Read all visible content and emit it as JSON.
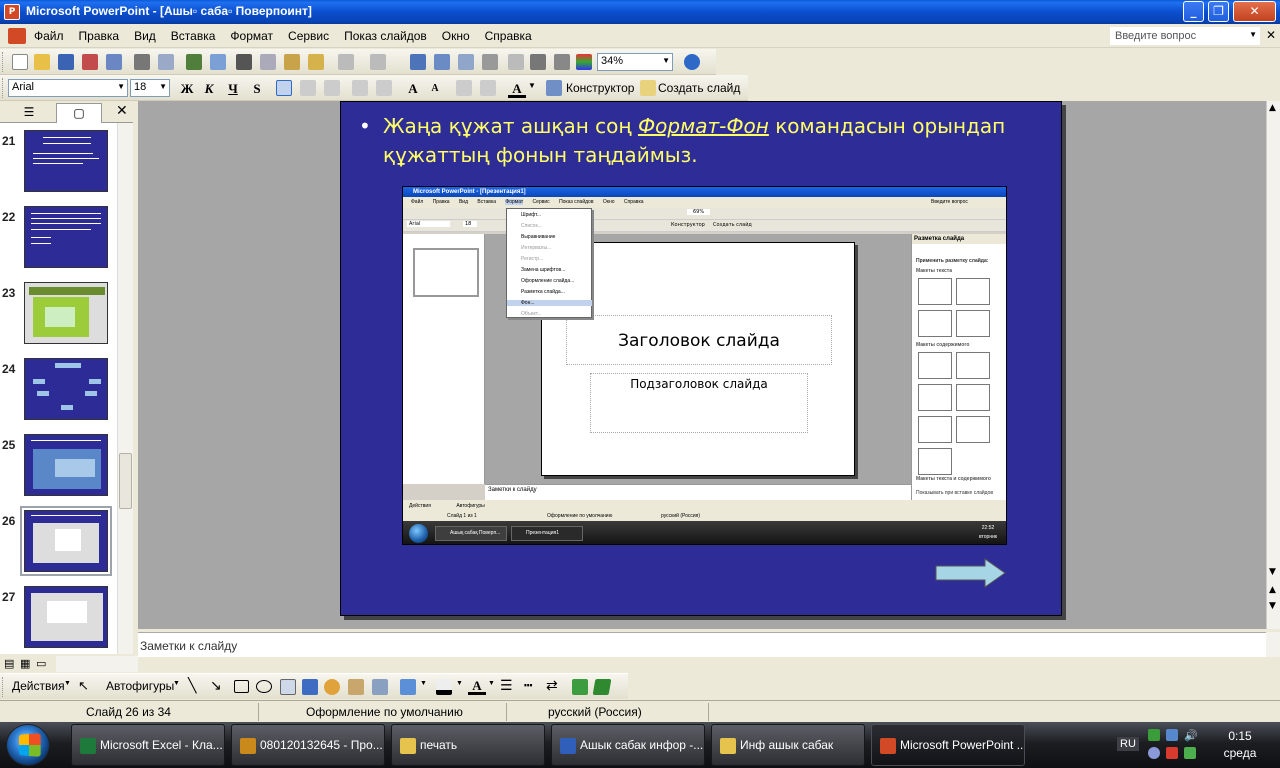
{
  "window": {
    "title": "Microsoft PowerPoint - [Ашы\u0000 саба\u0000 Поверпоинт]",
    "title_display": "Microsoft PowerPoint - [Ашы▫ саба▫ Поверпоинт]",
    "minimize": "_",
    "restore": "❐",
    "close": "✕"
  },
  "menu": {
    "items": [
      "Файл",
      "Правка",
      "Вид",
      "Вставка",
      "Формат",
      "Сервис",
      "Показ слайдов",
      "Окно",
      "Справка"
    ],
    "question_placeholder": "Введите вопрос",
    "doc_close": "✕"
  },
  "toolbar_standard": {
    "zoom": "34%"
  },
  "toolbar_formatting": {
    "font": "Arial",
    "size": "18",
    "bold": "Ж",
    "italic": "К",
    "underline": "Ч",
    "shadow": "S",
    "constructor": "Конструктор",
    "create_slide": "Создать слайд"
  },
  "outline": {
    "close": "✕",
    "thumbs": [
      {
        "num": "21"
      },
      {
        "num": "22"
      },
      {
        "num": "23"
      },
      {
        "num": "24"
      },
      {
        "num": "25"
      },
      {
        "num": "26"
      },
      {
        "num": "27"
      }
    ]
  },
  "slide": {
    "bullet_pre": "Жаңа құжат ашқан соң ",
    "bullet_emph": "Формат-Фон",
    "bullet_post": " командасын орындап құжаттың фонын таңдаймыз.",
    "shot": {
      "title": "Microsoft PowerPoint - [Презентация1]",
      "menu": [
        "Файл",
        "Правка",
        "Вид",
        "Вставка",
        "Формат",
        "Сервис",
        "Показ слайдов",
        "Окно",
        "Справка"
      ],
      "question": "Введите вопрос",
      "font": "Arial",
      "size": "18",
      "zoom": "69%",
      "constructor": "Конструктор",
      "create_slide": "Создать слайд",
      "format_menu": [
        "Шрифт...",
        "Список...",
        "Выравнивание",
        "Интервалы...",
        "Регистр...",
        "Замена шрифтов...",
        "Оформление слайда...",
        "Разметка слайда...",
        "Фон...",
        "Объект..."
      ],
      "slide_title": "Заголовок слайда",
      "slide_subtitle": "Подзаголовок слайда",
      "notes": "Заметки к слайду",
      "pane_title": "Разметка слайда",
      "pane_apply": "Применить разметку слайда:",
      "pane_text_layouts": "Макеты текста",
      "pane_content_layouts": "Макеты содержимого",
      "pane_text_content": "Макеты текста и содержимого",
      "pane_show": "Показывать при вставке слайдов",
      "draw_actions": "Действия",
      "draw_autoshapes": "Автофигуры",
      "status_slide": "Слайд 1 из 1",
      "status_design": "Оформление по умолчанию",
      "status_lang": "русский (Россия)",
      "task1": "Ашық сабақ Поверп...",
      "task2": "Презентация1",
      "time": "22:52",
      "day": "вторник"
    }
  },
  "notes": {
    "text": "Заметки к слайду"
  },
  "drawing": {
    "actions": "Действия",
    "autoshapes": "Автофигуры"
  },
  "status": {
    "slide": "Слайд 26 из 34",
    "design": "Оформление по умолчанию",
    "lang": "русский (Россия)"
  },
  "taskbar": {
    "tasks": [
      {
        "label": "Microsoft Excel - Кла...",
        "color": "#1d7a3a"
      },
      {
        "label": "080120132645 - Про...",
        "color": "#c98a1b"
      },
      {
        "label": "печать",
        "color": "#e6c34c"
      },
      {
        "label": "Ашык сабак инфор -...",
        "color": "#2f5fb8"
      },
      {
        "label": "Инф ашык сабак",
        "color": "#e6c34c"
      },
      {
        "label": "Microsoft PowerPoint ...",
        "color": "#d24a25"
      }
    ],
    "lang": "RU",
    "time": "0:15",
    "day": "среда"
  },
  "colors": {
    "slide_bg": "#2e2d97",
    "bullet_text": "#ffff66",
    "accent": "#0b4fcf"
  }
}
